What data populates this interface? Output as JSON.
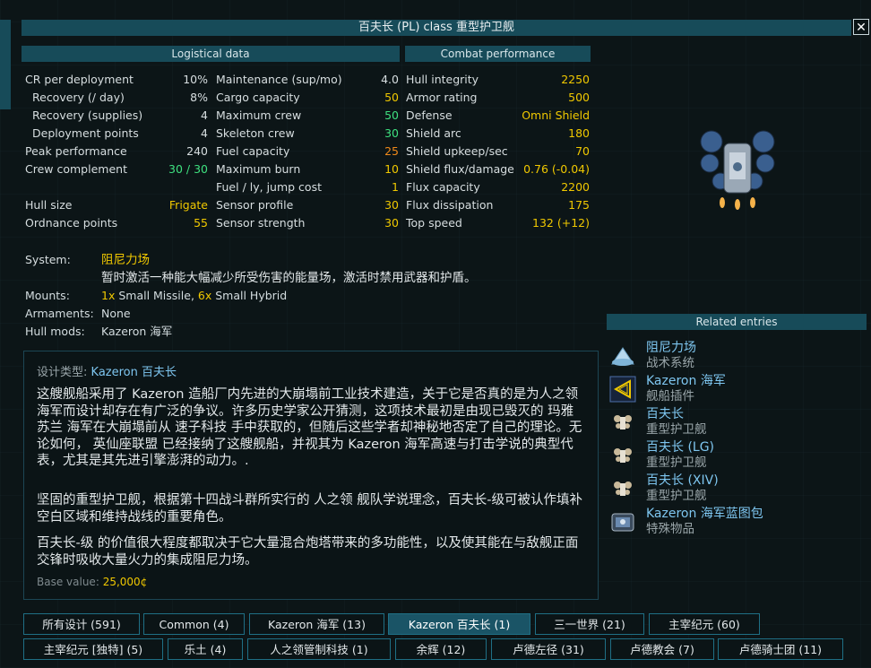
{
  "title": "百夫长 (PL) class 重型护卫舰",
  "headers": {
    "logistical": "Logistical data",
    "combat": "Combat performance"
  },
  "col1": [
    {
      "label": "CR per deployment",
      "value": "10%",
      "indent": false,
      "color": "w"
    },
    {
      "label": "Recovery (/ day)",
      "value": "8%",
      "indent": true,
      "color": "w"
    },
    {
      "label": "Recovery (supplies)",
      "value": "4",
      "indent": true,
      "color": "w"
    },
    {
      "label": "Deployment points",
      "value": "4",
      "indent": true,
      "color": "w"
    },
    {
      "label": "Peak performance",
      "value": "240",
      "indent": false,
      "color": "w"
    },
    {
      "label": "Crew complement",
      "value": "30 / 30",
      "indent": false,
      "color": "g"
    },
    {
      "label": "",
      "value": "",
      "indent": false,
      "color": "w"
    },
    {
      "label": "Hull size",
      "value": "Frigate",
      "indent": false,
      "color": "y"
    },
    {
      "label": "Ordnance points",
      "value": "55",
      "indent": false,
      "color": "y"
    }
  ],
  "col2": [
    {
      "label": "Maintenance (sup/mo)",
      "value": "4.0",
      "color": "w"
    },
    {
      "label": "Cargo capacity",
      "value": "50",
      "color": "y"
    },
    {
      "label": "Maximum crew",
      "value": "50",
      "color": "g"
    },
    {
      "label": "Skeleton crew",
      "value": "30",
      "color": "g"
    },
    {
      "label": "Fuel capacity",
      "value": "25",
      "color": "o"
    },
    {
      "label": "Maximum burn",
      "value": "10",
      "color": "y"
    },
    {
      "label": "Fuel / ly, jump cost",
      "value": "1",
      "color": "y"
    },
    {
      "label": "Sensor profile",
      "value": "30",
      "color": "y"
    },
    {
      "label": "Sensor strength",
      "value": "30",
      "color": "y"
    }
  ],
  "col3": [
    {
      "label": "Hull integrity",
      "value": "2250",
      "color": "y"
    },
    {
      "label": "Armor rating",
      "value": "500",
      "color": "y"
    },
    {
      "label": "Defense",
      "value": "Omni Shield",
      "color": "y"
    },
    {
      "label": "Shield arc",
      "value": "180",
      "color": "y"
    },
    {
      "label": "Shield upkeep/sec",
      "value": "70",
      "color": "y"
    },
    {
      "label": "Shield flux/damage",
      "value": "0.76 (-0.04)",
      "color": "y"
    },
    {
      "label": "Flux capacity",
      "value": "2200",
      "color": "y"
    },
    {
      "label": "Flux dissipation",
      "value": "175",
      "color": "y"
    },
    {
      "label": "Top speed",
      "value": "132 (+12)",
      "color": "y"
    }
  ],
  "system": {
    "label": "System:",
    "name": "阻尼力场",
    "desc": "暂时激活一种能大幅减少所受伤害的能量场，激活时禁用武器和护盾。"
  },
  "mounts": {
    "label": "Mounts:",
    "n1": "1x",
    "t1": " Small Missile, ",
    "n2": "6x",
    "t2": " Small Hybrid"
  },
  "armaments": {
    "label": "Armaments:",
    "value": "None"
  },
  "hullmods": {
    "label": "Hull mods:",
    "value": "Kazeron 海军"
  },
  "description": {
    "type_label": "设计类型:",
    "type_value": "Kazeron 百夫长",
    "p1": "这艘舰船采用了 Kazeron 造船厂内先进的大崩塌前工业技术建造，关于它是否真的是为人之领海军而设计却存在有广泛的争议。许多历史学家公开猜测，这项技术最初是由现已毁灭的 玛雅苏兰 海军在大崩塌前从 速子科技 手中获取的，但随后这些学者却神秘地否定了自己的理论。无论如何， 英仙座联盟 已经接纳了这艘舰船，并视其为 Kazeron 海军高速与打击学说的典型代表，尤其是其先进引擎澎湃的动力。.",
    "p2": "坚固的重型护卫舰，根据第十四战斗群所实行的 人之领 舰队学说理念，百夫长-级可被认作填补空白区域和维持战线的重要角色。",
    "p3": "百夫长-级 的价值很大程度都取决于它大量混合炮塔带来的多功能性，以及使其能在与敌舰正面交锋时吸收大量火力的集成阻尼力场。",
    "base_label": "Base value:",
    "base_value": "25,000¢"
  },
  "related": {
    "header": "Related entries",
    "items": [
      {
        "title": "阻尼力场",
        "sub": "战术系统",
        "icon": "damper-field-icon"
      },
      {
        "title": "Kazeron 海军",
        "sub": "舰船插件",
        "icon": "hullmod-icon"
      },
      {
        "title": "百夫长",
        "sub": "重型护卫舰",
        "icon": "ship-icon"
      },
      {
        "title": "百夫长 (LG)",
        "sub": "重型护卫舰",
        "icon": "ship-icon"
      },
      {
        "title": "百夫长 (XIV)",
        "sub": "重型护卫舰",
        "icon": "ship-icon"
      },
      {
        "title": "Kazeron 海军蓝图包",
        "sub": "特殊物品",
        "icon": "blueprint-icon"
      }
    ]
  },
  "tabs_row1": [
    {
      "label": "所有设计 (591)",
      "active": false
    },
    {
      "label": "Common (4)",
      "active": false
    },
    {
      "label": "Kazeron 海军 (13)",
      "active": false
    },
    {
      "label": "Kazeron 百夫长 (1)",
      "active": true
    },
    {
      "label": "三一世界 (21)",
      "active": false
    },
    {
      "label": "主宰纪元 (60)",
      "active": false
    }
  ],
  "tabs_row2": [
    {
      "label": "主宰纪元 [独特] (5)",
      "active": false
    },
    {
      "label": "乐土 (4)",
      "active": false
    },
    {
      "label": "人之领管制科技 (1)",
      "active": false
    },
    {
      "label": "余辉 (12)",
      "active": false
    },
    {
      "label": "卢德左径 (31)",
      "active": false
    },
    {
      "label": "卢德教会 (7)",
      "active": false
    },
    {
      "label": "卢德骑士团 (11)",
      "active": false
    }
  ]
}
